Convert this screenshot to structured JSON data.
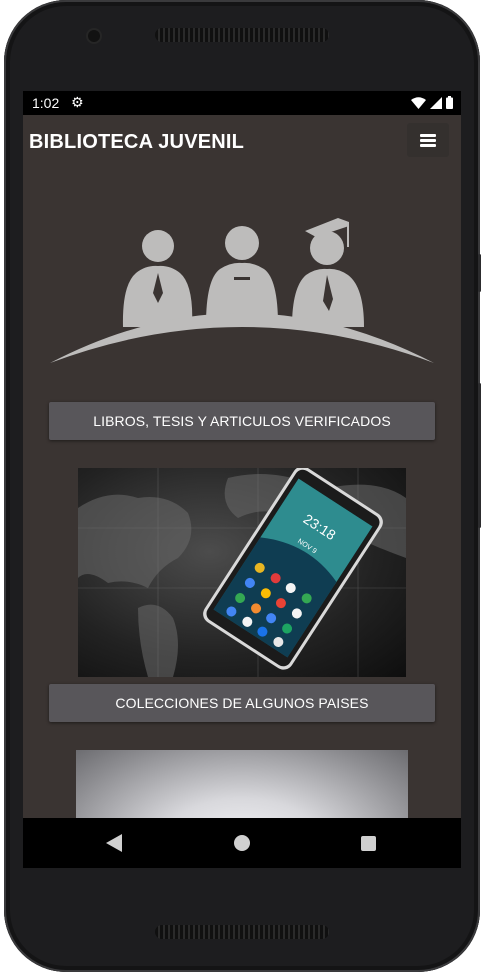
{
  "statusbar": {
    "time": "1:02",
    "icons": [
      "gear-icon",
      "wifi-icon",
      "signal-icon",
      "battery-icon"
    ]
  },
  "appbar": {
    "title": "BIBLIOTECA JUVENIL",
    "menu_icon": "menu-icon"
  },
  "hero": {
    "icon": "graduates-icon"
  },
  "buttons": {
    "libros": "LIBROS, TESIS Y ARTICULOS VERIFICADOS",
    "colecciones": "COLECCIONES DE ALGUNOS PAISES"
  },
  "phone_image": {
    "clock": "23:18",
    "date": "NOV 9"
  },
  "navigation": {
    "back": "back-icon",
    "home": "home-icon",
    "recents": "recents-icon"
  },
  "colors": {
    "background": "#3a3432",
    "button": "#58565a",
    "statusbar": "#000000",
    "text": "#ffffff"
  }
}
